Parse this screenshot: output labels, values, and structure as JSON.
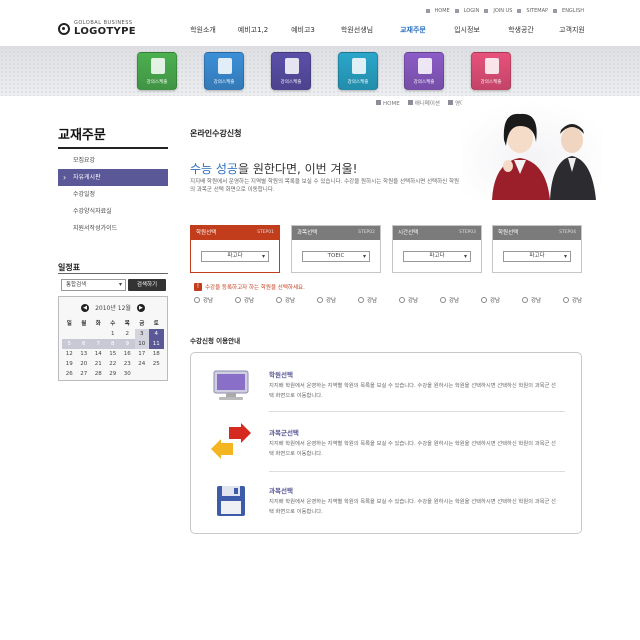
{
  "header": {
    "logo_small": "GOLOBAL BUSINESS",
    "logo_big": "LOGOTYPE",
    "util": [
      "HOME",
      "LOGIN",
      "JOIN US",
      "SITEMAP",
      "ENGLISH"
    ],
    "gnb": [
      "학원소개",
      "예비고1,2",
      "예비고3",
      "학원선생님",
      "교재주문",
      "입시정보",
      "학생공간",
      "고객지원"
    ],
    "gnb_active_index": 4
  },
  "quick": [
    {
      "label": "강의스케줄",
      "color": "#4caf50"
    },
    {
      "label": "강의스케줄",
      "color": "#3c8fd8"
    },
    {
      "label": "강의스케줄",
      "color": "#5a4fa8"
    },
    {
      "label": "강의스케줄",
      "color": "#2aa6c9"
    },
    {
      "label": "강의스케줄",
      "color": "#8b5cc6"
    },
    {
      "label": "강의스케줄",
      "color": "#e6517a"
    }
  ],
  "breadcrumb": [
    "HOME",
    "애니메이션",
    "영어"
  ],
  "sidebar": {
    "title": "교재주문",
    "items": [
      "모집요강",
      "자유게시판",
      "수강일정",
      "수강양식자료실",
      "지원서작성가이드"
    ],
    "selected_index": 1
  },
  "schedule": {
    "title": "일정표",
    "select_value": "통합검색",
    "button": "검색하기",
    "month": "2010년 12월",
    "weekdays": [
      "일",
      "월",
      "화",
      "수",
      "목",
      "금",
      "토"
    ],
    "weeks": [
      [
        "",
        "",
        "",
        "1",
        "2",
        "3",
        "4"
      ],
      [
        "5",
        "6",
        "7",
        "8",
        "9",
        "10",
        "11"
      ],
      [
        "12",
        "13",
        "14",
        "15",
        "16",
        "17",
        "18"
      ],
      [
        "19",
        "20",
        "21",
        "22",
        "23",
        "24",
        "25"
      ],
      [
        "26",
        "27",
        "28",
        "29",
        "30",
        "",
        ""
      ]
    ]
  },
  "main": {
    "title": "온라인수강신청",
    "headline_a": "수능 성공",
    "headline_b": "을 원한다면, 이번 겨울!",
    "intro": "지지배 학원에서 운영하는 지역별 학원의 목록을 보실 수 있습니다. 수강을 원하시는 학원을 선택하시면 선택하신 학원의 과목군 선택 화면으로 이동합니다.",
    "steps": [
      {
        "label": "학원선택",
        "step": "STEP01",
        "value": "파고다",
        "active": true
      },
      {
        "label": "과목선택",
        "step": "STEP02",
        "value": "TOEIC",
        "active": false
      },
      {
        "label": "시간선택",
        "step": "STEP03",
        "value": "파고다",
        "active": false
      },
      {
        "label": "학원선택",
        "step": "STEP04",
        "value": "파고다",
        "active": false
      }
    ],
    "warning": "수강을 등록하고자 하는 학원을 선택하세요.",
    "warning_icon": "!",
    "radios": [
      "강남",
      "강남",
      "강남",
      "강남",
      "강남",
      "강남",
      "강남",
      "강남",
      "강남",
      "강남"
    ]
  },
  "guide": {
    "title": "수강신청 이용안내",
    "items": [
      {
        "title": "학원선택",
        "desc": "지지배 학원에서 운영하는 지역별 학원의 목록을 보실 수 있습니다. 수강을 원하시는 학원을 선택하시면 선택하신 학원의 과목군 선택 화면으로 이동합니다.",
        "icon": "monitor-icon"
      },
      {
        "title": "과목군선택",
        "desc": "지지배 학원에서 운영하는 지역별 학원의 목록을 보실 수 있습니다. 수강을 원하시는 학원을 선택하시면 선택하신 학원의 과목군 선택 화면으로 이동합니다.",
        "icon": "arrows-icon"
      },
      {
        "title": "과목선택",
        "desc": "지지배 학원에서 운영하는 지역별 학원의 목록을 보실 수 있습니다. 수강을 원하시는 학원을 선택하시면 선택하신 학원의 과목군 선택 화면으로 이동합니다.",
        "icon": "floppy-icon"
      }
    ]
  }
}
